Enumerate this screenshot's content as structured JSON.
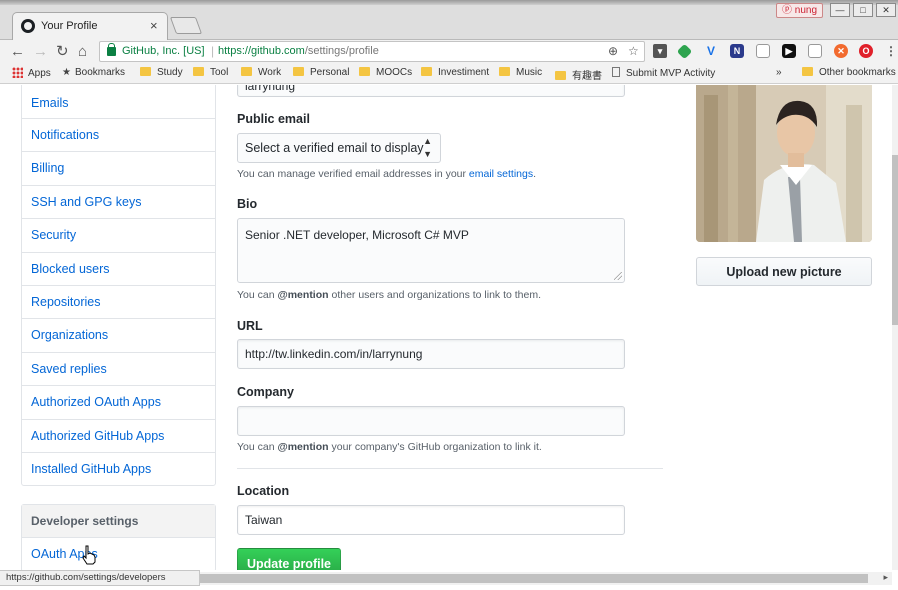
{
  "browser": {
    "tab_title": "Your Profile",
    "tab_close": "×",
    "user_badge": "nung",
    "window_min": "—",
    "window_max": "□",
    "window_close": "✕",
    "secure_label": "GitHub, Inc. [US]",
    "url_host": "https://github.com",
    "url_path": "/settings/profile",
    "bookmarks": {
      "apps": "Apps",
      "bookmarks": "Bookmarks",
      "folders": [
        "Study",
        "Tool",
        "Work",
        "Personal",
        "MOOCs",
        "Investiment",
        "Music",
        "有趣書"
      ],
      "submit": "Submit MVP Activity",
      "overflow": "»",
      "other": "Other bookmarks"
    }
  },
  "sidebar": {
    "items": [
      "Emails",
      "Notifications",
      "Billing",
      "SSH and GPG keys",
      "Security",
      "Blocked users",
      "Repositories",
      "Organizations",
      "Saved replies",
      "Authorized OAuth Apps",
      "Authorized GitHub Apps",
      "Installed GitHub Apps"
    ],
    "developer_header": "Developer settings",
    "developer_items": [
      "OAuth Apps"
    ]
  },
  "form": {
    "name_value": "larrynung",
    "public_email_label": "Public email",
    "public_email_select": "Select a verified email to display",
    "public_email_note_prefix": "You can manage verified email addresses in your ",
    "public_email_note_link": "email settings",
    "public_email_note_suffix": ".",
    "bio_label": "Bio",
    "bio_value": "Senior .NET developer, Microsoft C# MVP",
    "bio_note_prefix": "You can ",
    "bio_note_mention": "@mention",
    "bio_note_suffix": " other users and organizations to link to them.",
    "url_label": "URL",
    "url_value": "http://tw.linkedin.com/in/larrynung",
    "company_label": "Company",
    "company_value": "",
    "company_note_prefix": "You can ",
    "company_note_mention": "@mention",
    "company_note_suffix": " your company's GitHub organization to link it.",
    "location_label": "Location",
    "location_value": "Taiwan",
    "update_button": "Update profile"
  },
  "profile_picture": {
    "upload_button": "Upload new picture"
  },
  "status": {
    "url": "https://github.com/settings/developers"
  },
  "colors": {
    "link": "#0366d6",
    "update_green": "#28a745",
    "secure_green": "#0b8043"
  }
}
